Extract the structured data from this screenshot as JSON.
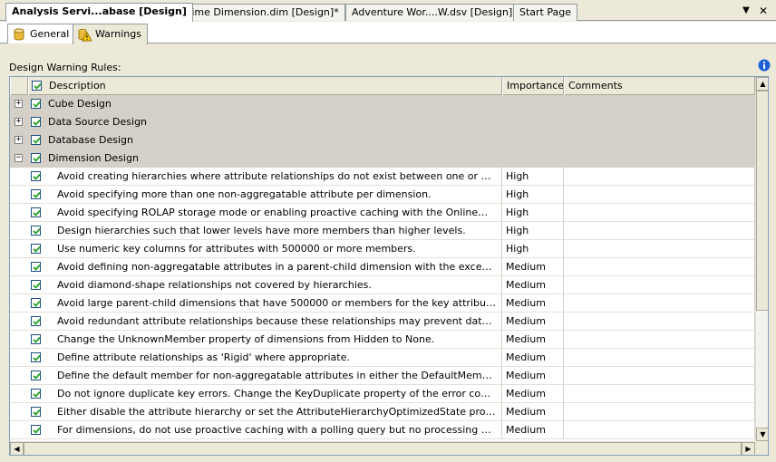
{
  "doc_tabs": [
    {
      "label": "Analysis Servi...abase [Design]",
      "active": true
    },
    {
      "label": "Time Dimension.dim [Design]*",
      "active": false
    },
    {
      "label": "Adventure Wor....W.dsv [Design]",
      "active": false
    },
    {
      "label": "Start Page",
      "active": false
    }
  ],
  "inner_tabs": [
    {
      "label": "General",
      "icon": "database-icon",
      "active": false
    },
    {
      "label": "Warnings",
      "icon": "warning-icon",
      "active": true
    }
  ],
  "section_label": "Design Warning Rules:",
  "columns": {
    "description": "Description",
    "importance": "Importance",
    "comments": "Comments"
  },
  "categories": [
    {
      "label": "Cube Design",
      "expanded": false
    },
    {
      "label": "Data Source Design",
      "expanded": false
    },
    {
      "label": "Database Design",
      "expanded": false
    },
    {
      "label": "Dimension Design",
      "expanded": true
    }
  ],
  "rules": [
    {
      "description": "Avoid creating hierarchies where attribute relationships do not exist between one or more levels.",
      "importance": "High"
    },
    {
      "description": "Avoid specifying more than one non-aggregatable attribute per dimension.",
      "importance": "High"
    },
    {
      "description": "Avoid specifying ROLAP storage mode or enabling proactive caching with the OnlineMode propert...",
      "importance": "High"
    },
    {
      "description": "Design hierarchies such that lower levels have more members than higher levels.",
      "importance": "High"
    },
    {
      "description": "Use numeric key columns for attributes with 500000 or more members.",
      "importance": "High"
    },
    {
      "description": "Avoid defining non-aggregatable attributes in a parent-child dimension with the exception of the p...",
      "importance": "Medium"
    },
    {
      "description": "Avoid diamond-shape relationships not covered by hierarchies.",
      "importance": "Medium"
    },
    {
      "description": "Avoid large parent-child dimensions that have 500000 or members for the key attribute.",
      "importance": "Medium"
    },
    {
      "description": "Avoid redundant attribute relationships because these relationships may prevent data from being ...",
      "importance": "Medium"
    },
    {
      "description": "Change the UnknownMember property of dimensions from Hidden to None.",
      "importance": "Medium"
    },
    {
      "description": "Define attribute relationships as 'Rigid' where appropriate.",
      "importance": "Medium"
    },
    {
      "description": "Define the default member for non-aggregatable attributes in either the DefaultMember property ...",
      "importance": "Medium"
    },
    {
      "description": "Do not ignore duplicate key errors. Change the KeyDuplicate property of the error configuration s...",
      "importance": "Medium"
    },
    {
      "description": "Either disable the attribute hierarchy or set the AttributeHierarchyOptimizedState property to Not...",
      "importance": "Medium"
    },
    {
      "description": "For dimensions, do not use proactive caching with a polling query but no processing query.",
      "importance": "Medium"
    }
  ],
  "colors": {
    "category_bg": "#d4d0c8",
    "chrome_bg": "#ece9d8",
    "checkbox_border": "#1c5180",
    "check_mark": "#21a121"
  }
}
